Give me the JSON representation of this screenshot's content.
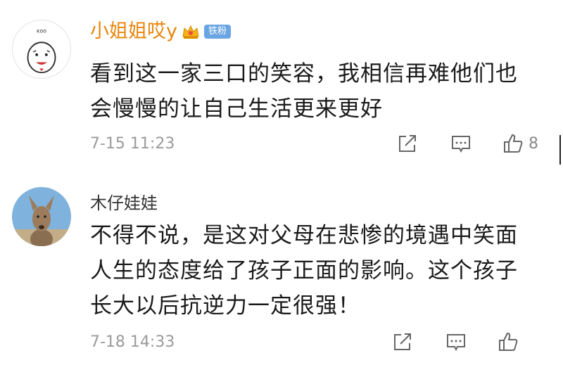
{
  "comments": [
    {
      "username": "小姐姐哎y",
      "badge": "铁粉",
      "avatar": "cartoon-face-avatar",
      "avatar_text": "ᴋᴏᴏ",
      "lines": [
        "看到这一家三口的笑容，我相信再难他们也",
        "会慢慢的让自己生活更来更好"
      ],
      "time": "7-15 11:23",
      "likes": "8"
    },
    {
      "username": "木仔娃娃",
      "avatar": "kangaroo-avatar",
      "lines": [
        "不得不说，是这对父母在悲惨的境遇中笑面",
        "人生的态度给了孩子正面的影响。这个孩子",
        "长大以后抗逆力一定很强！"
      ],
      "time": "7-18 14:33"
    }
  ],
  "icons": {
    "share": "share-icon",
    "comment": "comment-icon",
    "like": "thumbs-up-icon",
    "crown": "crown-icon"
  },
  "colors": {
    "vip_name": "#e8850c",
    "badge_bg": "#6aa5e3",
    "meta": "#9a9a9a"
  }
}
